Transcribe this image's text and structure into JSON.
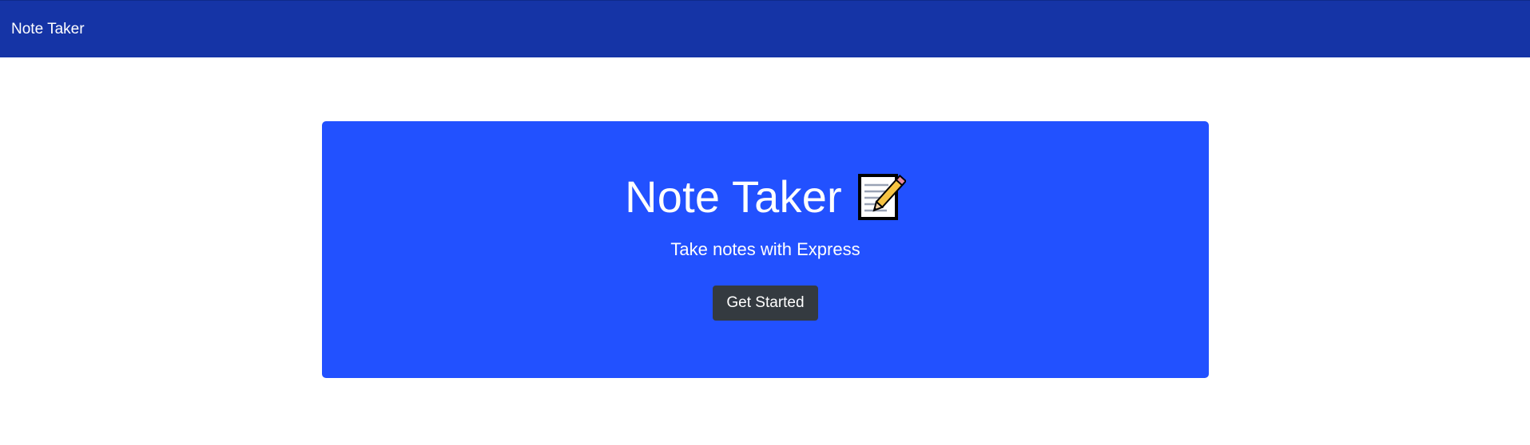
{
  "navbar": {
    "brand": "Note Taker",
    "background_color": "#1534a6"
  },
  "hero": {
    "title": "Note Taker",
    "title_icon": "memo-icon",
    "subtitle": "Take notes with Express",
    "background_color": "#2251ff",
    "button": {
      "label": "Get Started",
      "background_color": "#343a40"
    }
  }
}
